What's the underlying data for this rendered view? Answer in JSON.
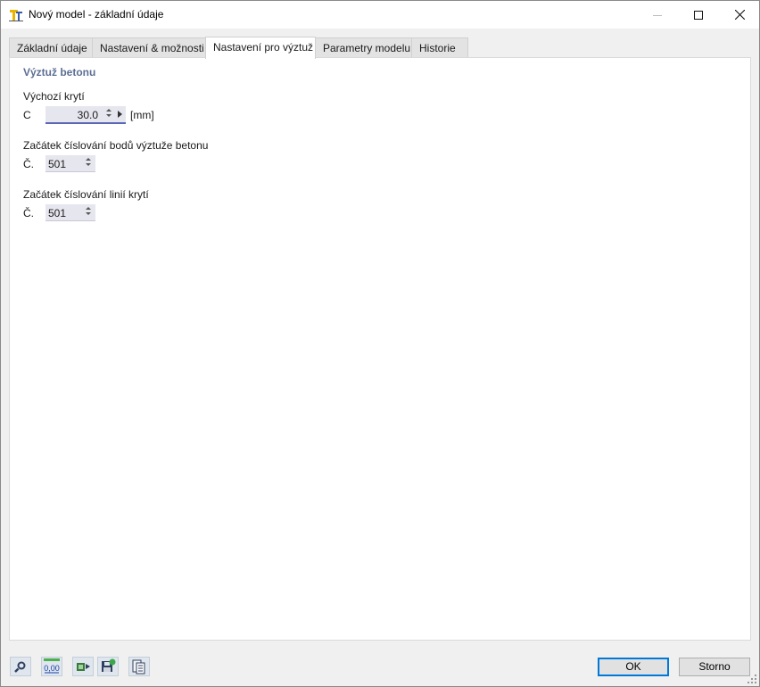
{
  "window": {
    "title": "Nový model - základní údaje"
  },
  "tabs": [
    {
      "label": "Základní údaje",
      "active": false
    },
    {
      "label": "Nastavení & možnosti",
      "active": false
    },
    {
      "label": "Nastavení pro výztuž",
      "active": true
    },
    {
      "label": "Parametry modelu",
      "active": false
    },
    {
      "label": "Historie",
      "active": false
    }
  ],
  "section": {
    "title": "Výztuž betonu",
    "default_cover": {
      "heading": "Výchozí krytí",
      "symbol": "C",
      "value": "30.0",
      "unit": "[mm]"
    },
    "rebar_point_numbering": {
      "heading": "Začátek číslování bodů výztuže betonu",
      "symbol": "Č.",
      "value": "501"
    },
    "cover_line_numbering": {
      "heading": "Začátek číslování linií krytí",
      "symbol": "Č.",
      "value": "501"
    }
  },
  "footer": {
    "tools": [
      "help-search-icon",
      "units-decimal-icon",
      "export-icon",
      "save-template-icon",
      "document-list-icon"
    ],
    "tool_units_label": "0,00",
    "ok_label": "OK",
    "cancel_label": "Storno"
  },
  "colors": {
    "section_title": "#5c6f94",
    "field_bg": "#e6e6ef",
    "focus_underline": "#5b66b5",
    "default_button_border": "#0078d7"
  }
}
